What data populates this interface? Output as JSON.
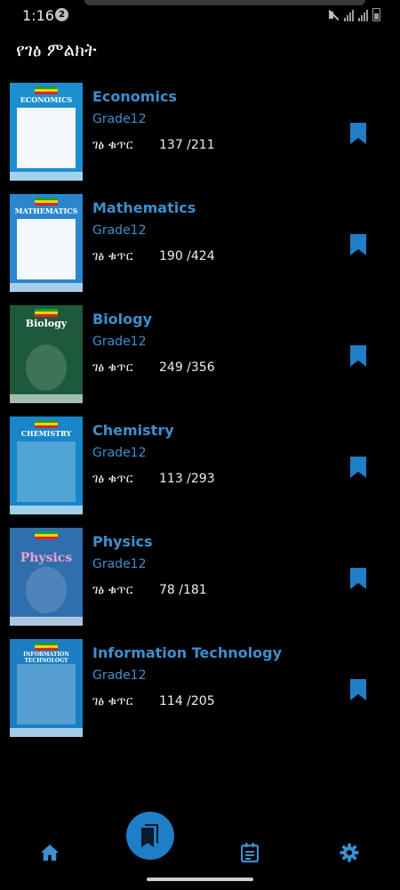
{
  "status_bar": {
    "time": "1:16",
    "notification_count": "2"
  },
  "page": {
    "title": "የገፅ ምልክት"
  },
  "colors": {
    "accent": "#3d8fce",
    "fab": "#1e7ec8",
    "background": "#000000"
  },
  "books": [
    {
      "title": "Economics",
      "grade": "Grade12",
      "page_label": "ገፅ ቁጥር",
      "pages": "137 /211",
      "cover_title": "ECONOMICS",
      "cover_color": "#1b8fd0"
    },
    {
      "title": "Mathematics",
      "grade": "Grade12",
      "page_label": "ገፅ ቁጥር",
      "pages": "190 /424",
      "cover_title": "MATHEMATICS",
      "cover_color": "#2a86cf"
    },
    {
      "title": "Biology",
      "grade": "Grade12",
      "page_label": "ገፅ ቁጥር",
      "pages": "249 /356",
      "cover_title": "Biology",
      "cover_color": "#1d5a3c"
    },
    {
      "title": "Chemistry",
      "grade": "Grade12",
      "page_label": "ገፅ ቁጥር",
      "pages": "113 /293",
      "cover_title": "CHEMISTRY",
      "cover_color": "#1686c9"
    },
    {
      "title": "Physics",
      "grade": "Grade12",
      "page_label": "ገፅ ቁጥር",
      "pages": "78 /181",
      "cover_title": "Physics",
      "cover_color": "#2f6fae"
    },
    {
      "title": "Information Technology",
      "grade": "Grade12",
      "page_label": "ገፅ ቁጥር",
      "pages": "114 /205",
      "cover_title": "INFORMATION TECHNOLOGY",
      "cover_color": "#1b7ec2"
    }
  ],
  "nav": {
    "items": [
      {
        "icon": "home-icon"
      },
      {
        "icon": "bookmarks-icon",
        "active": true
      },
      {
        "icon": "calendar-icon"
      },
      {
        "icon": "settings-icon"
      }
    ]
  }
}
